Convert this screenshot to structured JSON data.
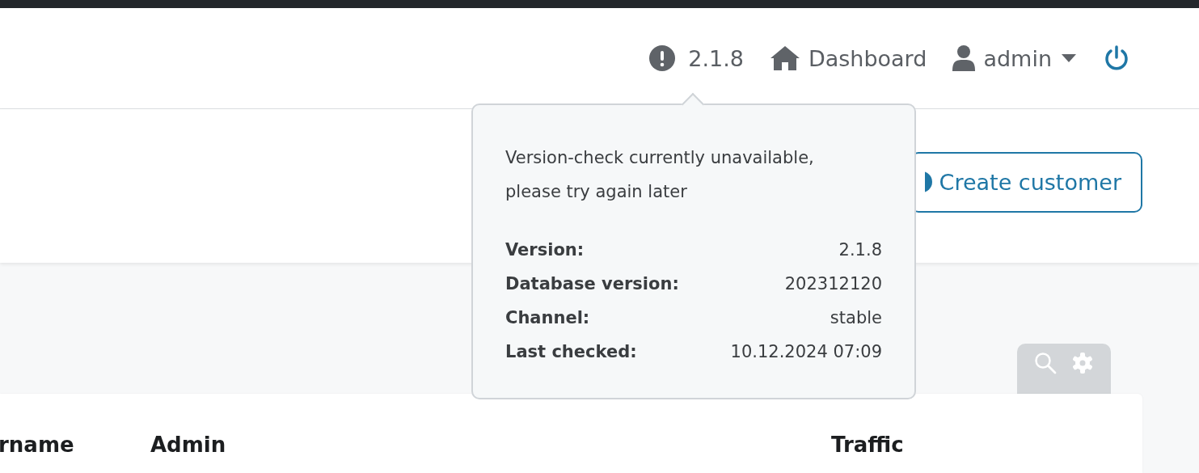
{
  "navbar": {
    "version": "2.1.8",
    "dashboard": "Dashboard",
    "user": "admin"
  },
  "header": {
    "create_button": "Create customer"
  },
  "popover": {
    "message": "Version-check currently unavailable, please try again later",
    "rows": [
      {
        "label": "Version:",
        "value": "2.1.8"
      },
      {
        "label": "Database version:",
        "value": "202312120"
      },
      {
        "label": "Channel:",
        "value": "stable"
      },
      {
        "label": "Last checked:",
        "value": "10.12.2024 07:09"
      }
    ]
  },
  "table": {
    "columns": [
      "rname",
      "Admin",
      "Traffic"
    ]
  }
}
